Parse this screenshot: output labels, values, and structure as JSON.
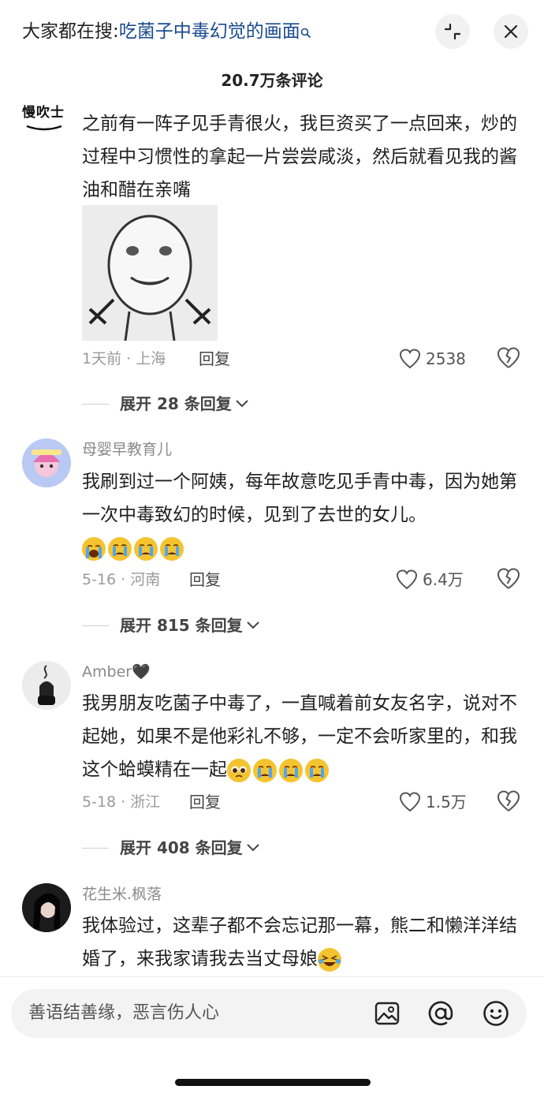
{
  "header": {
    "search_prefix": "大家都在搜:",
    "search_query": "吃菌子中毒幻觉的画面",
    "comment_count": "20.7万条评论"
  },
  "comments": [
    {
      "username": "慢吹士",
      "text": "之前有一阵子见手青很火，我巨资买了一点回来，炒的过程中习惯性的拿起一片尝尝咸淡，然后就看见我的酱油和醋在亲嘴",
      "has_sticker": true,
      "meta": "1天前 · 上海",
      "reply_label": "回复",
      "likes": "2538",
      "expand": "展开 28 条回复"
    },
    {
      "username": "母婴早教育儿",
      "text": "我刷到过一个阿姨，每年故意吃见手青中毒，因为她第一次中毒致幻的时候，见到了去世的女儿。",
      "emojis": [
        "loudly-crying-emoji",
        "crying-emoji",
        "crying-emoji",
        "crying-emoji"
      ],
      "meta": "5-16 · 河南",
      "reply_label": "回复",
      "likes": "6.4万",
      "expand": "展开 815 条回复"
    },
    {
      "username": "Amber🖤",
      "text": "我男朋友吃菌子中毒了，一直喊着前女友名字，说对不起她，如果不是他彩礼不够，一定不会听家里的，和我这个蛤蟆精在一起",
      "emojis": [
        "pleading-emoji",
        "crying-emoji",
        "crying-emoji",
        "crying-emoji"
      ],
      "meta": "5-18 · 浙江",
      "reply_label": "回复",
      "likes": "1.5万",
      "expand": "展开 408 条回复"
    },
    {
      "username": "花生米.枫落",
      "text": "我体验过，这辈子都不会忘记那一幕，熊二和懒洋洋结婚了，来我家请我去当丈母娘",
      "emojis": [
        "laughing-tears-emoji"
      ]
    }
  ],
  "input": {
    "placeholder": "善语结善缘，恶言伤人心"
  },
  "colors": {
    "query_blue": "#1a4b8f",
    "meta_gray": "#9a9a9a",
    "emoji_yellow": "#f4c430"
  }
}
